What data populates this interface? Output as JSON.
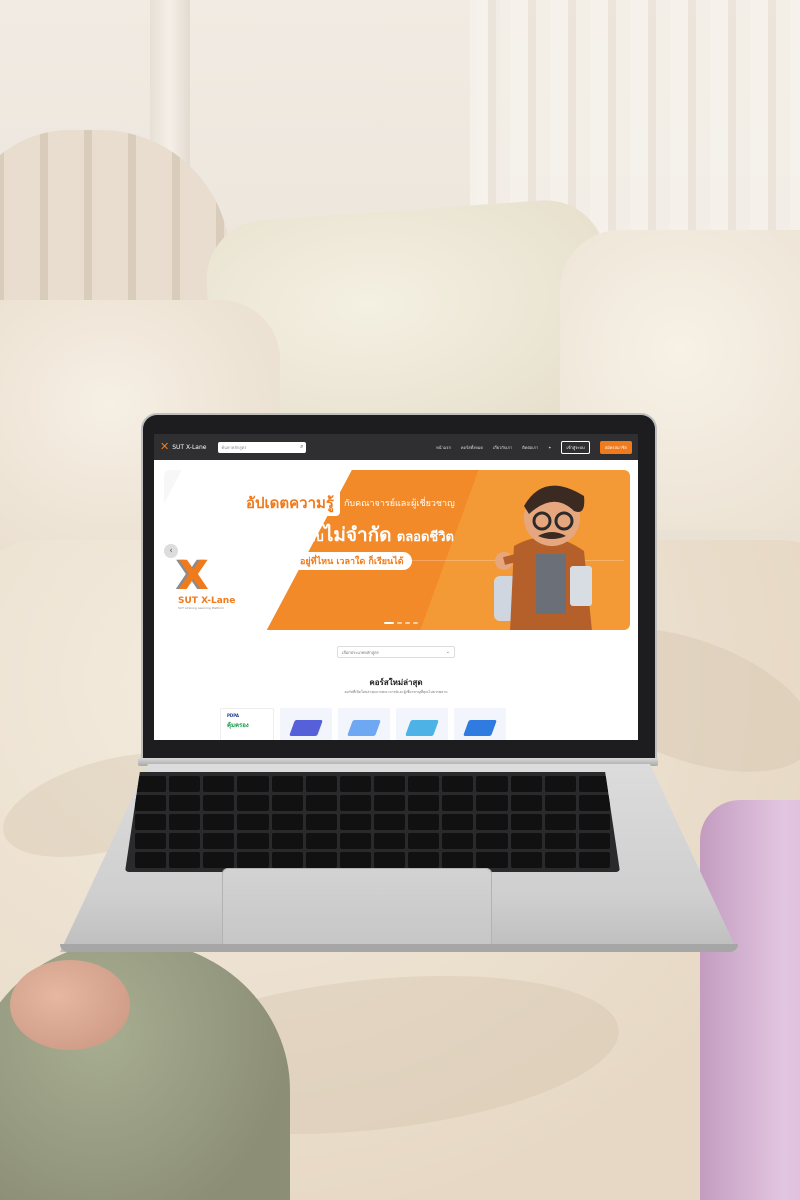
{
  "site": {
    "brand": "SUT X-Lane",
    "search_placeholder": "ค้นหาหลักสูตร",
    "nav": [
      "หน้าแรก",
      "คอร์สทั้งหมด",
      "เกี่ยวกับเรา",
      "ติดต่อเรา"
    ],
    "login": "เข้าสู่ระบบ",
    "register": "สมัครสมาชิก"
  },
  "banner": {
    "line1_highlight": "อัปเดตความรู้",
    "line1_rest": "กับคณาจารย์และผู้เชี่ยวชาญ",
    "line2_a": "เรียนรู้แบบ",
    "line2_b": "ไม่จำกัด",
    "line2_c": "ตลอดชีวิต",
    "line3": "อยู่ที่ไหน เวลาใด ก็เรียนได้",
    "logo_name": "SUT X-Lane",
    "logo_tag": "SUT Lifelong Learning Platform"
  },
  "filter": {
    "placeholder": "เลือกประเภทหลักสูตร"
  },
  "section": {
    "title": "คอร์สใหม่ล่าสุด",
    "subtitle": "คอร์สที่เปิดใหม่ล่าสุดจากคณาจารย์และผู้เชี่ยวชาญที่คุณไม่ควรพลาด"
  },
  "cards": [
    {
      "tag": "PDPA",
      "title": "คุ้มครอง"
    },
    {
      "tag": "",
      "title": ""
    },
    {
      "tag": "",
      "title": ""
    },
    {
      "tag": "",
      "title": ""
    },
    {
      "tag": "",
      "title": ""
    }
  ],
  "colors": {
    "accent": "#f07b1d",
    "topbar": "#2f2f31"
  }
}
